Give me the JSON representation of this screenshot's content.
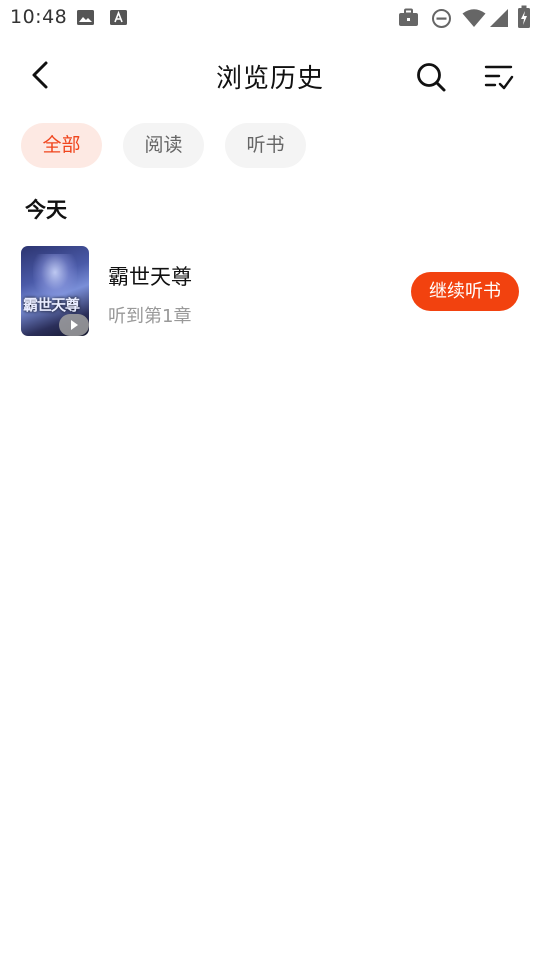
{
  "status_bar": {
    "time": "10:48",
    "icons": [
      "image-icon",
      "text-icon",
      "briefcase-icon",
      "dnd-icon",
      "wifi-icon",
      "signal-icon",
      "battery-charging-icon"
    ]
  },
  "header": {
    "title": "浏览历史",
    "back_icon": "chevron-left-icon",
    "search_icon": "search-icon",
    "sort_icon": "sort-check-icon"
  },
  "filters": {
    "items": [
      {
        "label": "全部",
        "active": true
      },
      {
        "label": "阅读",
        "active": false
      },
      {
        "label": "听书",
        "active": false
      }
    ]
  },
  "colors": {
    "accent": "#f2420f",
    "chip_active_bg": "#fde9e3",
    "chip_bg": "#f4f4f4"
  },
  "sections": [
    {
      "title": "今天",
      "items": [
        {
          "cover_text": "霸世天尊",
          "title": "霸世天尊",
          "progress": "听到第1章",
          "action": "继续听书"
        }
      ]
    }
  ]
}
